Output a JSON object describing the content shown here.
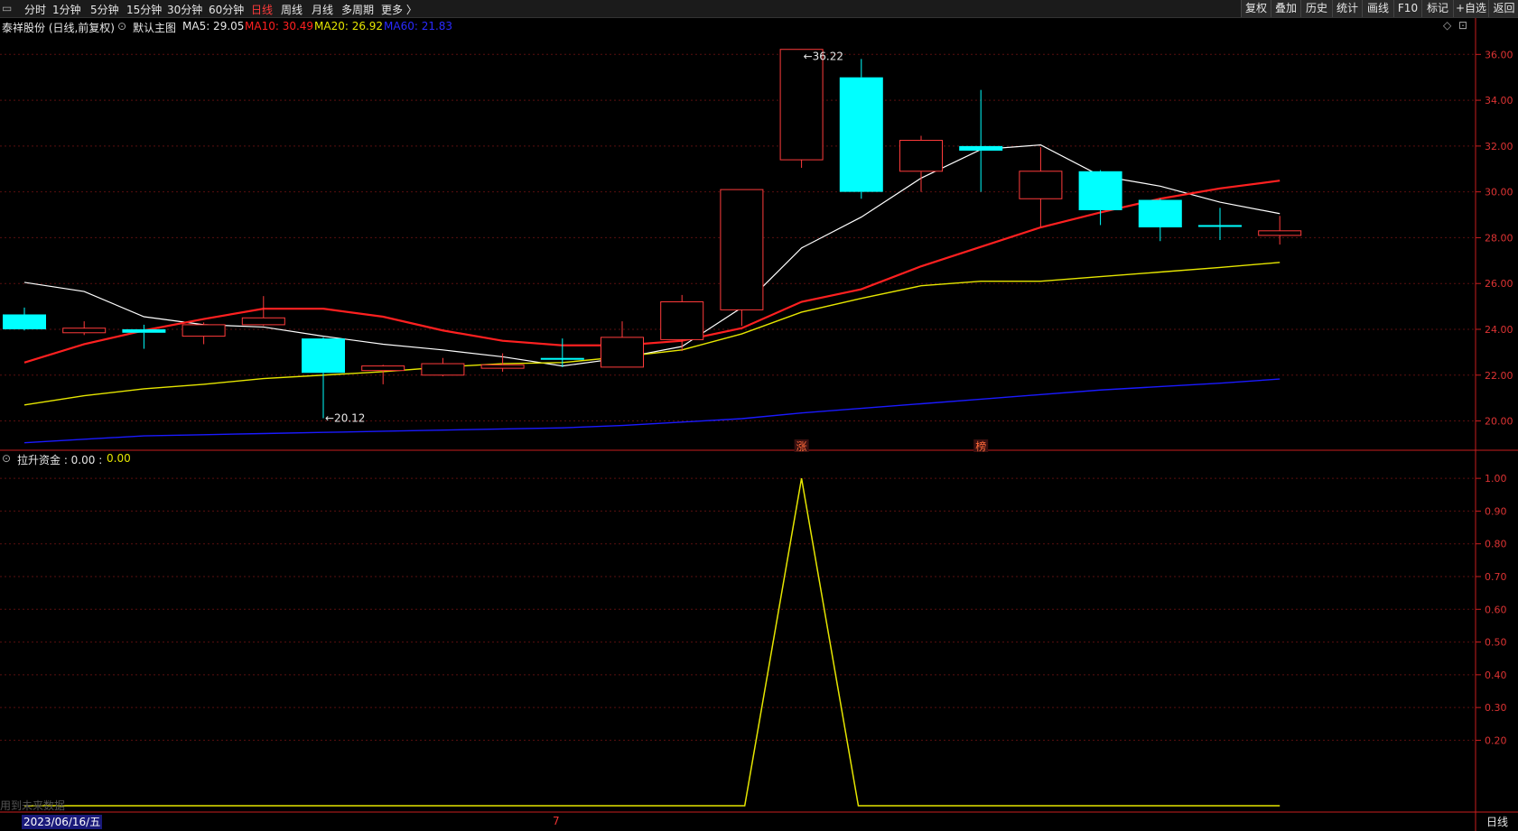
{
  "toolbar": {
    "left_icon": "window-icon",
    "periods": [
      {
        "label": "分时",
        "active": false
      },
      {
        "label": "1分钟",
        "active": false
      },
      {
        "label": "5分钟",
        "active": false
      },
      {
        "label": "15分钟",
        "active": false
      },
      {
        "label": "30分钟",
        "active": false
      },
      {
        "label": "60分钟",
        "active": false
      },
      {
        "label": "日线",
        "active": true
      },
      {
        "label": "周线",
        "active": false
      },
      {
        "label": "月线",
        "active": false
      },
      {
        "label": "多周期",
        "active": false
      },
      {
        "label": "更多 〉",
        "active": false
      }
    ],
    "right_buttons": [
      "复权",
      "叠加",
      "历史",
      "统计",
      "画线",
      "F10",
      "标记",
      "+自选",
      "返回"
    ]
  },
  "main_legend": {
    "title": "泰祥股份 (日线,前复权)",
    "template": "默认主图",
    "ma5": "MA5: 29.05",
    "ma10": "MA10: 30.49",
    "ma20": "MA20: 26.92",
    "ma60": "MA60: 21.83",
    "icons": [
      "diamond-icon",
      "expand-icon"
    ]
  },
  "indicator_legend": {
    "name": "拉升资金 : 0.00 : ",
    "value": "0.00"
  },
  "colors": {
    "up": "#ff3b3b",
    "down": "#00ffff",
    "ma5": "#ffffff",
    "ma10": "#ff2020",
    "ma20": "#e6e600",
    "ma60": "#1a1aff",
    "axis": "#c81e1e",
    "indicator": "#e6e600"
  },
  "chart_data": [
    {
      "type": "candlestick",
      "title": "泰祥股份 (日线,前复权)",
      "ylim": [
        18.8,
        36.8
      ],
      "y_ticks": [
        "20.00",
        "22.00",
        "24.00",
        "26.00",
        "28.00",
        "30.00",
        "32.00",
        "34.00",
        "36.00"
      ],
      "candles": [
        {
          "o": 24.65,
          "h": 24.95,
          "l": 23.95,
          "c": 24.0
        },
        {
          "o": 23.85,
          "h": 24.35,
          "l": 23.75,
          "c": 24.05
        },
        {
          "o": 24.0,
          "h": 24.2,
          "l": 23.15,
          "c": 23.85
        },
        {
          "o": 23.7,
          "h": 24.3,
          "l": 23.35,
          "c": 24.2
        },
        {
          "o": 24.2,
          "h": 25.45,
          "l": 24.15,
          "c": 24.5
        },
        {
          "o": 23.6,
          "h": 23.65,
          "l": 20.12,
          "c": 22.1
        },
        {
          "o": 22.2,
          "h": 22.45,
          "l": 21.6,
          "c": 22.4
        },
        {
          "o": 22.0,
          "h": 22.75,
          "l": 21.95,
          "c": 22.5
        },
        {
          "o": 22.3,
          "h": 22.95,
          "l": 22.15,
          "c": 22.45
        },
        {
          "o": 22.75,
          "h": 23.6,
          "l": 22.35,
          "c": 22.7
        },
        {
          "o": 22.35,
          "h": 24.35,
          "l": 22.35,
          "c": 23.65
        },
        {
          "o": 23.55,
          "h": 25.5,
          "l": 23.05,
          "c": 25.2
        },
        {
          "o": 24.85,
          "h": 30.1,
          "l": 24.15,
          "c": 30.1
        },
        {
          "o": 31.4,
          "h": 36.22,
          "l": 31.05,
          "c": 36.22
        },
        {
          "o": 35.0,
          "h": 35.8,
          "l": 29.7,
          "c": 30.0
        },
        {
          "o": 30.9,
          "h": 32.45,
          "l": 30.0,
          "c": 32.25
        },
        {
          "o": 32.0,
          "h": 34.45,
          "l": 30.0,
          "c": 31.8
        },
        {
          "o": 29.7,
          "h": 31.95,
          "l": 28.45,
          "c": 30.9
        },
        {
          "o": 30.9,
          "h": 30.95,
          "l": 28.55,
          "c": 29.2
        },
        {
          "o": 29.65,
          "h": 29.7,
          "l": 27.85,
          "c": 28.45
        },
        {
          "o": 28.55,
          "h": 29.3,
          "l": 27.9,
          "c": 28.5
        },
        {
          "o": 28.1,
          "h": 28.95,
          "l": 27.7,
          "c": 28.3
        }
      ],
      "series": [
        {
          "name": "MA5",
          "values": [
            26.05,
            25.65,
            24.55,
            24.2,
            24.1,
            23.7,
            23.35,
            23.1,
            22.8,
            22.4,
            22.75,
            23.25,
            24.95,
            27.55,
            28.9,
            30.6,
            31.85,
            32.05,
            30.7,
            30.25,
            29.55,
            29.05
          ]
        },
        {
          "name": "MA10",
          "values": [
            22.55,
            23.35,
            23.95,
            24.45,
            24.9,
            24.9,
            24.55,
            23.95,
            23.5,
            23.3,
            23.3,
            23.5,
            24.05,
            25.2,
            25.75,
            26.75,
            27.6,
            28.45,
            29.1,
            29.7,
            30.15,
            30.49
          ]
        },
        {
          "name": "MA20",
          "values": [
            20.7,
            21.1,
            21.4,
            21.6,
            21.85,
            22.0,
            22.15,
            22.35,
            22.5,
            22.55,
            22.8,
            23.1,
            23.8,
            24.75,
            25.35,
            25.9,
            26.1,
            26.1,
            26.3,
            26.5,
            26.7,
            26.92
          ]
        },
        {
          "name": "MA60",
          "values": [
            19.05,
            19.2,
            19.35,
            19.4,
            19.45,
            19.5,
            19.55,
            19.6,
            19.65,
            19.7,
            19.8,
            19.95,
            20.1,
            20.35,
            20.55,
            20.75,
            20.95,
            21.15,
            21.35,
            21.5,
            21.65,
            21.83
          ]
        }
      ],
      "annotations": [
        {
          "text": "36.22",
          "candle_index": 13,
          "at": "high"
        },
        {
          "text": "20.12",
          "candle_index": 5,
          "at": "low"
        }
      ],
      "markers": [
        {
          "text": "涨",
          "candle_index": 13
        },
        {
          "text": "榜",
          "candle_index": 16
        }
      ]
    },
    {
      "type": "line",
      "title": "拉升资金",
      "ylim": [
        0,
        1.05
      ],
      "y_ticks": [
        "0.20",
        "0.30",
        "0.40",
        "0.50",
        "0.60",
        "0.70",
        "0.80",
        "0.90",
        "1.00"
      ],
      "series": [
        {
          "name": "拉升资金",
          "values": [
            0,
            0,
            0,
            0,
            0,
            0,
            0,
            0,
            0,
            0,
            0,
            0,
            0,
            1,
            0,
            0,
            0,
            0,
            0,
            0,
            0,
            0
          ]
        }
      ]
    }
  ],
  "footer": {
    "date": "2023/06/16/五",
    "mark": "7",
    "future_note": "用到未来数据",
    "cycle": "日线"
  }
}
